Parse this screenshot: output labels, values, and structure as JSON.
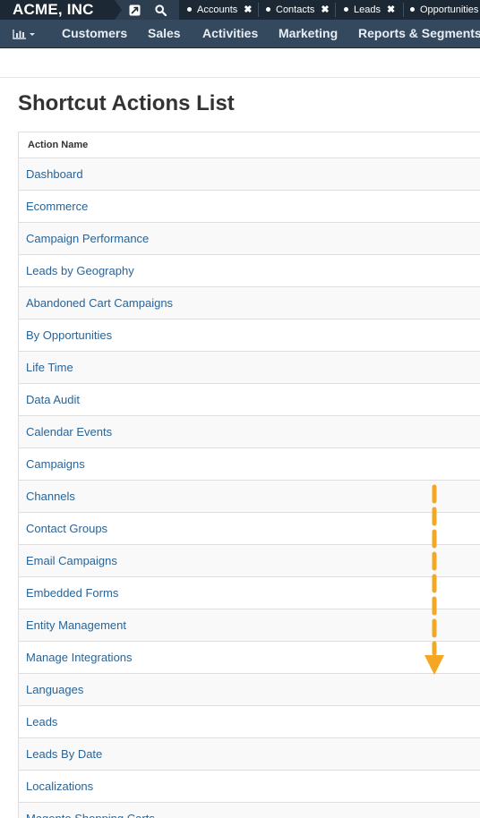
{
  "topbar": {
    "brand": "ACME, INC",
    "icons": [
      "external-link-icon",
      "search-icon"
    ],
    "tabs": [
      {
        "label": "Accounts",
        "closable": true
      },
      {
        "label": "Contacts",
        "closable": true
      },
      {
        "label": "Leads",
        "closable": true
      },
      {
        "label": "Opportunities",
        "closable": false
      }
    ],
    "close_glyph": "✖"
  },
  "navbar": {
    "menu_icon": "bar-chart-icon",
    "items": [
      "Customers",
      "Sales",
      "Activities",
      "Marketing",
      "Reports & Segments"
    ]
  },
  "page": {
    "title": "Shortcut Actions List",
    "table": {
      "header": "Action Name",
      "rows": [
        "Dashboard",
        "Ecommerce",
        "Campaign Performance",
        "Leads by Geography",
        "Abandoned Cart Campaigns",
        "By Opportunities",
        "Life Time",
        "Data Audit",
        "Calendar Events",
        "Campaigns",
        "Channels",
        "Contact Groups",
        "Email Campaigns",
        "Embedded Forms",
        "Entity Management",
        "Manage Integrations",
        "Languages",
        "Leads",
        "Leads By Date",
        "Localizations",
        "Magento Shopping Carts"
      ]
    }
  },
  "colors": {
    "topbar": "#1c2833",
    "navbar": "#34495e",
    "link": "#2a6496",
    "annotation_arrow": "#f5a623"
  }
}
